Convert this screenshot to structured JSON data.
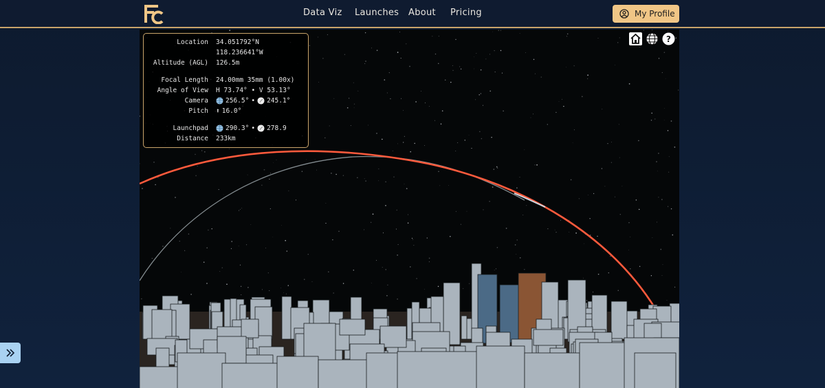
{
  "nav": {
    "items": [
      {
        "label": "Data Viz"
      },
      {
        "label": "Launches"
      },
      {
        "label": "About"
      },
      {
        "label": "Pricing"
      }
    ],
    "profile_label": "My Profile",
    "profile_icon": "user-circle-icon",
    "logo_icon": "fc-logo-icon"
  },
  "info": {
    "location_label": "Location",
    "location_lat": "34.051792°N",
    "location_lon": "118.236641°W",
    "altitude_label": "Altitude (AGL)",
    "altitude_value": "126.5m",
    "focal_label": "Focal Length",
    "focal_value": "24.00mm 35mm (1.00x)",
    "aov_label": "Angle of View",
    "aov_value": "H 73.74° • V 53.13°",
    "camera_label": "Camera",
    "camera_globe": "256.5°",
    "camera_sep": "•",
    "camera_compass": "245.1°",
    "pitch_label": "Pitch",
    "pitch_arrow": "⬆",
    "pitch_value": "16.0°",
    "launchpad_label": "Launchpad",
    "launchpad_globe": "290.3°",
    "launchpad_sep": "•",
    "launchpad_compass": "278.9",
    "distance_label": "Distance",
    "distance_value": "233km"
  },
  "tools": [
    "home-icon",
    "globe-icon",
    "help-icon"
  ],
  "colors": {
    "accent_gold": "#c9a46a",
    "profile_bg": "#f0c686",
    "trajectory": "#ff5a3c",
    "trajectory_ghost": "#9aa3a8",
    "building": "#aab4bd",
    "building_blue": "#4b6a86",
    "building_brown": "#8a5534",
    "side_toggle": "#a9d2f2"
  }
}
